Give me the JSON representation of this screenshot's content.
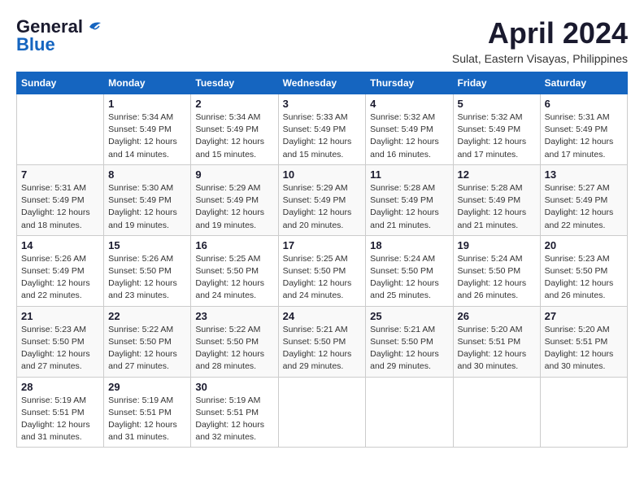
{
  "logo": {
    "line1": "General",
    "line2": "Blue"
  },
  "title": "April 2024",
  "location": "Sulat, Eastern Visayas, Philippines",
  "header_days": [
    "Sunday",
    "Monday",
    "Tuesday",
    "Wednesday",
    "Thursday",
    "Friday",
    "Saturday"
  ],
  "weeks": [
    [
      {
        "day": "",
        "sunrise": "",
        "sunset": "",
        "daylight": ""
      },
      {
        "day": "1",
        "sunrise": "Sunrise: 5:34 AM",
        "sunset": "Sunset: 5:49 PM",
        "daylight": "Daylight: 12 hours and 14 minutes."
      },
      {
        "day": "2",
        "sunrise": "Sunrise: 5:34 AM",
        "sunset": "Sunset: 5:49 PM",
        "daylight": "Daylight: 12 hours and 15 minutes."
      },
      {
        "day": "3",
        "sunrise": "Sunrise: 5:33 AM",
        "sunset": "Sunset: 5:49 PM",
        "daylight": "Daylight: 12 hours and 15 minutes."
      },
      {
        "day": "4",
        "sunrise": "Sunrise: 5:32 AM",
        "sunset": "Sunset: 5:49 PM",
        "daylight": "Daylight: 12 hours and 16 minutes."
      },
      {
        "day": "5",
        "sunrise": "Sunrise: 5:32 AM",
        "sunset": "Sunset: 5:49 PM",
        "daylight": "Daylight: 12 hours and 17 minutes."
      },
      {
        "day": "6",
        "sunrise": "Sunrise: 5:31 AM",
        "sunset": "Sunset: 5:49 PM",
        "daylight": "Daylight: 12 hours and 17 minutes."
      }
    ],
    [
      {
        "day": "7",
        "sunrise": "Sunrise: 5:31 AM",
        "sunset": "Sunset: 5:49 PM",
        "daylight": "Daylight: 12 hours and 18 minutes."
      },
      {
        "day": "8",
        "sunrise": "Sunrise: 5:30 AM",
        "sunset": "Sunset: 5:49 PM",
        "daylight": "Daylight: 12 hours and 19 minutes."
      },
      {
        "day": "9",
        "sunrise": "Sunrise: 5:29 AM",
        "sunset": "Sunset: 5:49 PM",
        "daylight": "Daylight: 12 hours and 19 minutes."
      },
      {
        "day": "10",
        "sunrise": "Sunrise: 5:29 AM",
        "sunset": "Sunset: 5:49 PM",
        "daylight": "Daylight: 12 hours and 20 minutes."
      },
      {
        "day": "11",
        "sunrise": "Sunrise: 5:28 AM",
        "sunset": "Sunset: 5:49 PM",
        "daylight": "Daylight: 12 hours and 21 minutes."
      },
      {
        "day": "12",
        "sunrise": "Sunrise: 5:28 AM",
        "sunset": "Sunset: 5:49 PM",
        "daylight": "Daylight: 12 hours and 21 minutes."
      },
      {
        "day": "13",
        "sunrise": "Sunrise: 5:27 AM",
        "sunset": "Sunset: 5:49 PM",
        "daylight": "Daylight: 12 hours and 22 minutes."
      }
    ],
    [
      {
        "day": "14",
        "sunrise": "Sunrise: 5:26 AM",
        "sunset": "Sunset: 5:49 PM",
        "daylight": "Daylight: 12 hours and 22 minutes."
      },
      {
        "day": "15",
        "sunrise": "Sunrise: 5:26 AM",
        "sunset": "Sunset: 5:50 PM",
        "daylight": "Daylight: 12 hours and 23 minutes."
      },
      {
        "day": "16",
        "sunrise": "Sunrise: 5:25 AM",
        "sunset": "Sunset: 5:50 PM",
        "daylight": "Daylight: 12 hours and 24 minutes."
      },
      {
        "day": "17",
        "sunrise": "Sunrise: 5:25 AM",
        "sunset": "Sunset: 5:50 PM",
        "daylight": "Daylight: 12 hours and 24 minutes."
      },
      {
        "day": "18",
        "sunrise": "Sunrise: 5:24 AM",
        "sunset": "Sunset: 5:50 PM",
        "daylight": "Daylight: 12 hours and 25 minutes."
      },
      {
        "day": "19",
        "sunrise": "Sunrise: 5:24 AM",
        "sunset": "Sunset: 5:50 PM",
        "daylight": "Daylight: 12 hours and 26 minutes."
      },
      {
        "day": "20",
        "sunrise": "Sunrise: 5:23 AM",
        "sunset": "Sunset: 5:50 PM",
        "daylight": "Daylight: 12 hours and 26 minutes."
      }
    ],
    [
      {
        "day": "21",
        "sunrise": "Sunrise: 5:23 AM",
        "sunset": "Sunset: 5:50 PM",
        "daylight": "Daylight: 12 hours and 27 minutes."
      },
      {
        "day": "22",
        "sunrise": "Sunrise: 5:22 AM",
        "sunset": "Sunset: 5:50 PM",
        "daylight": "Daylight: 12 hours and 27 minutes."
      },
      {
        "day": "23",
        "sunrise": "Sunrise: 5:22 AM",
        "sunset": "Sunset: 5:50 PM",
        "daylight": "Daylight: 12 hours and 28 minutes."
      },
      {
        "day": "24",
        "sunrise": "Sunrise: 5:21 AM",
        "sunset": "Sunset: 5:50 PM",
        "daylight": "Daylight: 12 hours and 29 minutes."
      },
      {
        "day": "25",
        "sunrise": "Sunrise: 5:21 AM",
        "sunset": "Sunset: 5:50 PM",
        "daylight": "Daylight: 12 hours and 29 minutes."
      },
      {
        "day": "26",
        "sunrise": "Sunrise: 5:20 AM",
        "sunset": "Sunset: 5:51 PM",
        "daylight": "Daylight: 12 hours and 30 minutes."
      },
      {
        "day": "27",
        "sunrise": "Sunrise: 5:20 AM",
        "sunset": "Sunset: 5:51 PM",
        "daylight": "Daylight: 12 hours and 30 minutes."
      }
    ],
    [
      {
        "day": "28",
        "sunrise": "Sunrise: 5:19 AM",
        "sunset": "Sunset: 5:51 PM",
        "daylight": "Daylight: 12 hours and 31 minutes."
      },
      {
        "day": "29",
        "sunrise": "Sunrise: 5:19 AM",
        "sunset": "Sunset: 5:51 PM",
        "daylight": "Daylight: 12 hours and 31 minutes."
      },
      {
        "day": "30",
        "sunrise": "Sunrise: 5:19 AM",
        "sunset": "Sunset: 5:51 PM",
        "daylight": "Daylight: 12 hours and 32 minutes."
      },
      {
        "day": "",
        "sunrise": "",
        "sunset": "",
        "daylight": ""
      },
      {
        "day": "",
        "sunrise": "",
        "sunset": "",
        "daylight": ""
      },
      {
        "day": "",
        "sunrise": "",
        "sunset": "",
        "daylight": ""
      },
      {
        "day": "",
        "sunrise": "",
        "sunset": "",
        "daylight": ""
      }
    ]
  ]
}
